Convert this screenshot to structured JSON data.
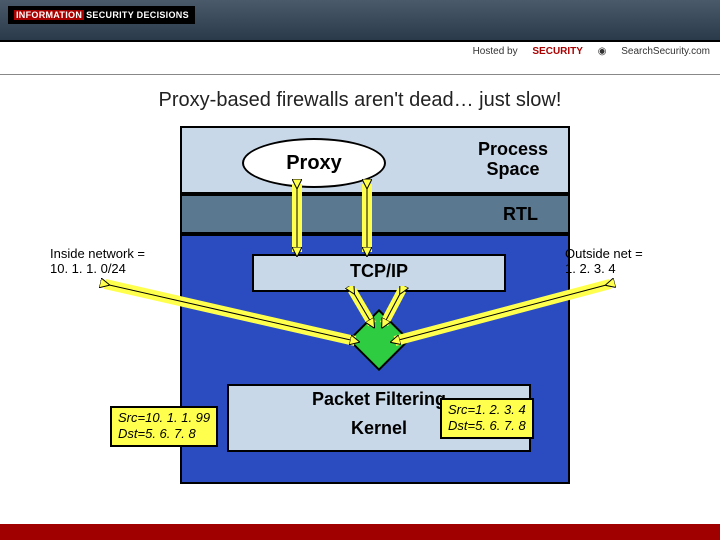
{
  "header": {
    "logo_prefix": "INFORMATION",
    "logo_main": "SECURITY DECISIONS",
    "hosted_by": "Hosted by",
    "sponsor1": "SECURITY",
    "sponsor2": "SearchSecurity.com"
  },
  "title": "Proxy-based firewalls aren't dead… just slow!",
  "diagram": {
    "proxy": "Proxy",
    "process_space": "Process\nSpace",
    "rtl": "RTL",
    "tcpip": "TCP/IP",
    "packet_filtering": "Packet Filtering",
    "kernel": "Kernel",
    "inside_label": "Inside network =",
    "inside_net": "10. 1. 1. 0/24",
    "outside_label": "Outside net =",
    "outside_net": "1. 2. 3. 4",
    "tag_left_l1": "Src=10. 1. 1. 99",
    "tag_left_l2": "Dst=5. 6. 7. 8",
    "tag_right_l1": "Src=1. 2. 3. 4",
    "tag_right_l2": "Dst=5. 6. 7. 8"
  }
}
